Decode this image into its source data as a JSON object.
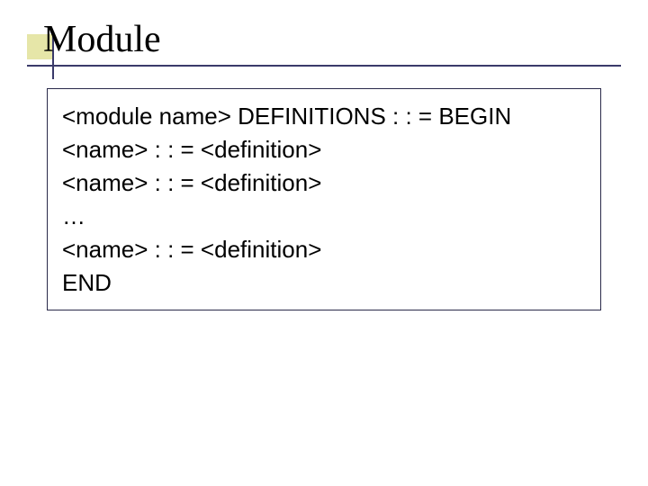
{
  "title": "Module",
  "lines": [
    "<module name> DEFINITIONS : : = BEGIN",
    "<name> : : = <definition>",
    "<name> : : = <definition>",
    "…",
    "<name> : : = <definition>",
    "END"
  ]
}
